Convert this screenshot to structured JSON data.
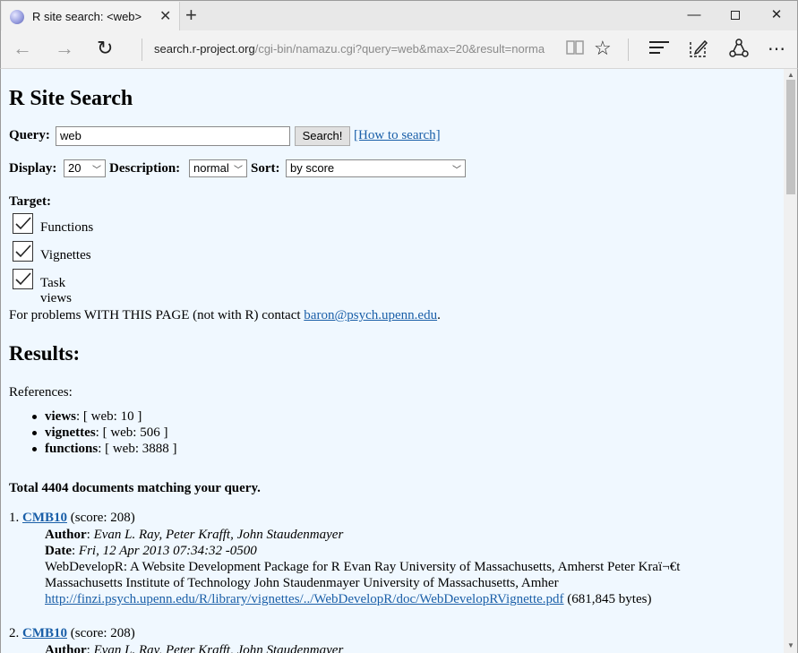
{
  "browser": {
    "tab_title": "R site search: <web>",
    "address_host": "search.r-project.org",
    "address_path": "/cgi-bin/namazu.cgi?query=web&max=20&result=norma",
    "address_prefix": "search."
  },
  "page": {
    "title": "R Site Search",
    "query_label": "Query:",
    "query_value": "web",
    "search_button": "Search!",
    "howto_link": "[How to search]",
    "display_label": "Display:",
    "display_value": "20",
    "description_label": "Description:",
    "description_value": "normal",
    "sort_label": "Sort:",
    "sort_value": "by score",
    "target_label": "Target:",
    "targets": [
      {
        "label": "Functions",
        "checked": true
      },
      {
        "label": "Vignettes",
        "checked": true
      },
      {
        "label": "Task views",
        "checked": true
      }
    ],
    "contact_text": "For problems WITH THIS PAGE (not with R) contact ",
    "contact_email": "baron@psych.upenn.edu",
    "contact_period": ".",
    "results_heading": "Results:",
    "references_label": "References:",
    "references": [
      {
        "term": "views",
        "detail": ": [ web: 10 ]"
      },
      {
        "term": "vignettes",
        "detail": ": [ web: 506 ]"
      },
      {
        "term": "functions",
        "detail": ": [ web: 3888 ]"
      }
    ],
    "total_text": "Total 4404 documents matching your query."
  },
  "results": [
    {
      "number": "1.",
      "title": "CMB10",
      "score": "(score: 208)",
      "author_label": "Author",
      "author": "Evan L. Ray, Peter Krafft, John Staudenmayer",
      "date_label": "Date",
      "date": "Fri, 12 Apr 2013 07:34:32 -0500",
      "summary_line1": "WebDevelopR: A Website Development Package for R Evan Ray University of Massachusetts, Amherst Peter Kraï¬€t",
      "summary_line2": "Massachusetts Institute of Technology John Staudenmayer University of Massachusetts, Amher",
      "url": "http://finzi.psych.upenn.edu/R/library/vignettes/../WebDevelopR/doc/WebDevelopRVignette.pdf",
      "size": "(681,845 bytes)"
    },
    {
      "number": "2.",
      "title": "CMB10",
      "score": "(score: 208)",
      "author_label": "Author",
      "author": "Evan L. Ray, Peter Krafft, John Staudenmayer"
    }
  ]
}
